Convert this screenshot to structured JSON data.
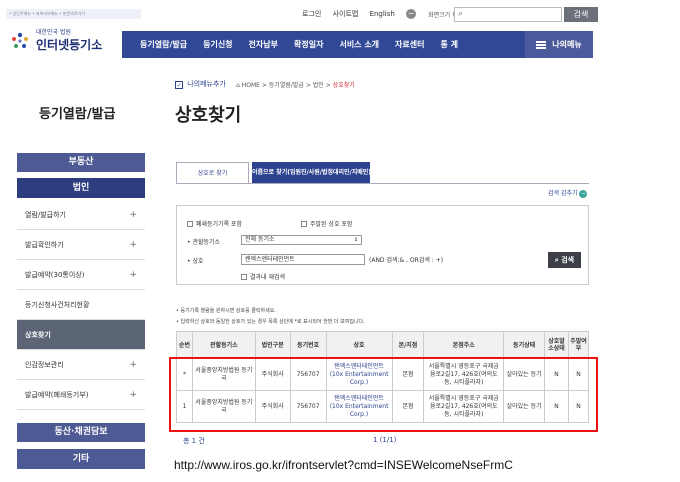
{
  "header": {
    "tiny_links": "• 상단주메뉴 • 좌측서브메뉴 • 본문바로가기",
    "util_links": [
      "로그인",
      "사이트맵",
      "English"
    ],
    "zoom_label": "화면크기",
    "zoom_minus": "−",
    "zoom_plus": "+",
    "search_button": "검색"
  },
  "logo": {
    "small_text": "대한민국 법원",
    "big_text": "인터넷등기소"
  },
  "nav": {
    "items": [
      "등기열람/발급",
      "등기신청",
      "전자납부",
      "확정일자",
      "서비스 소개",
      "자료센터",
      "통 계"
    ],
    "my_menu": "나의메뉴"
  },
  "sidebar": {
    "title": "등기열람/발급",
    "real_estate": "부동산",
    "corporation": "법인",
    "items": [
      {
        "label": "열람/발급하기",
        "plus": "+"
      },
      {
        "label": "발급확인하기",
        "plus": "+"
      },
      {
        "label": "발급예약(30통이상)",
        "plus": "+"
      },
      {
        "label": "등기신청사건처리현황",
        "plus": ""
      },
      {
        "label": "상호찾기",
        "plus": ""
      },
      {
        "label": "인감정보관리",
        "plus": "+"
      },
      {
        "label": "발급예약(폐쇄등기부)",
        "plus": "+"
      }
    ],
    "movable": "동산·채권담보",
    "etc": "기타"
  },
  "main": {
    "my_add": "나의메뉴추가",
    "my_add_check": "✓",
    "breadcrumb": "HOME > 등기열람/발급 > 법인 >",
    "breadcrumb_current": "상호찾기",
    "title": "상호찾기",
    "tabs": [
      "상호로 찾기",
      "이름으로 찾기(임원진/사원/법정대리인/지배인)"
    ],
    "detail_search": "검색 감추기",
    "detail_icon": "−",
    "form": {
      "closed_include": "폐쇄등기기록 포함",
      "main_office_only": "주말된 상호 포함",
      "registry_label": "• 관할등기소",
      "registry_value": "전체 등기소",
      "name_label": "• 상호",
      "name_value": "렌엑스엔터테인먼트",
      "hint": "(AND 검색:& , OR검색 : +)",
      "result_search": "결과내 재검색",
      "search_button": "검색"
    },
    "notes": [
      "• 등기기록 열람을 원하시면 상호를 클릭하세요.",
      "• 입력하신 상호와 동일한 상호가 있는 경우 목록 상단에 *로 표시되어 한번 더 보여집니다."
    ],
    "table": {
      "headers": [
        "순번",
        "관할등기소",
        "법인구분",
        "등기번호",
        "상호",
        "본/지점",
        "본점주소",
        "등기상태",
        "상호말소상태",
        "주말여부"
      ],
      "rows": [
        [
          "*",
          "서울중앙지방법원 등기국",
          "주식회사",
          "756707",
          "텐엑스엔터테인먼트 (10x Entertainment Corp.)",
          "본점",
          "서울특별시 영등포구 국제금융로2길17, 426호(여의도동, 시티플라자)",
          "살아있는 등기",
          "N",
          "N"
        ],
        [
          "1",
          "서울중앙지방법원 등기국",
          "주식회사",
          "756707",
          "텐엑스엔터테인먼트 (10x Entertainment Corp.)",
          "본점",
          "서울특별시 영등포구 국제금융로2길17, 426호(여의도동, 시티플라자)",
          "살아있는 등기",
          "N",
          "N"
        ]
      ]
    },
    "total": "총 1 건",
    "pages": "1  (1/1)"
  },
  "caption_url": "http://www.iros.go.kr/ifrontservlet?cmd=INSEWelcomeNseFrmC",
  "colors": {
    "nav_blue": "#304896",
    "highlight_red": "#ee1111",
    "link_blue": "#2d4390"
  }
}
